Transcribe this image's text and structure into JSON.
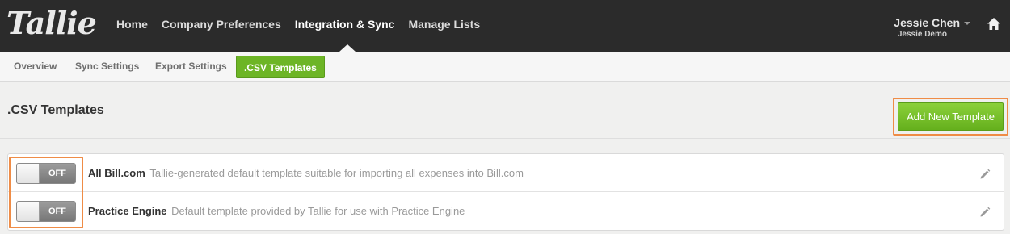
{
  "app": {
    "logo": "Tallie"
  },
  "main_nav": {
    "items": [
      {
        "label": "Home"
      },
      {
        "label": "Company Preferences"
      },
      {
        "label": "Integration & Sync"
      },
      {
        "label": "Manage Lists"
      }
    ],
    "active": "Integration & Sync"
  },
  "user": {
    "name": "Jessie Chen",
    "company": "Jessie Demo"
  },
  "icons": {
    "home": "home-icon",
    "user_menu": "chevron-down-icon",
    "edit": "pencil-icon"
  },
  "sub_nav": {
    "items": [
      {
        "label": "Overview"
      },
      {
        "label": "Sync Settings"
      },
      {
        "label": "Export Settings"
      },
      {
        "label": ".CSV Templates"
      }
    ],
    "active": ".CSV Templates"
  },
  "page": {
    "title": ".CSV Templates",
    "add_button": "Add New Template"
  },
  "templates": [
    {
      "toggle": "OFF",
      "name": "All Bill.com",
      "description": "Tallie-generated default template suitable for importing all expenses into Bill.com"
    },
    {
      "toggle": "OFF",
      "name": "Practice Engine",
      "description": "Default template provided by Tallie for use with Practice Engine"
    }
  ],
  "colors": {
    "topbar": "#2b2b2b",
    "accent_green": "#6db526",
    "highlight_orange": "#ef8c46"
  }
}
